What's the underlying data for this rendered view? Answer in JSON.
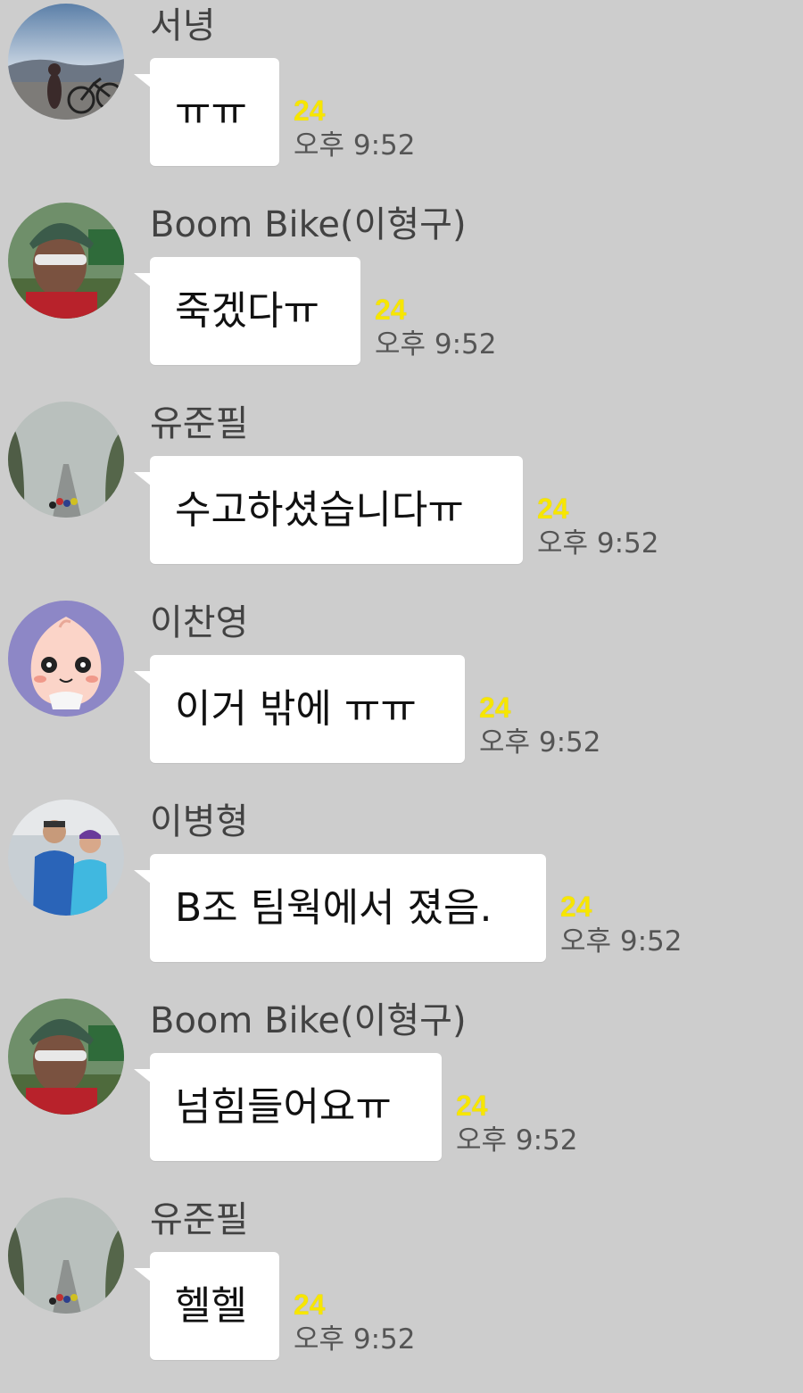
{
  "colors": {
    "background": "#cdcdcd",
    "bubble": "#ffffff",
    "unread_badge": "#f7e600",
    "sender_text": "#424242",
    "time_text": "#555555"
  },
  "messages": [
    {
      "sender": "서녕",
      "text": "ㅠㅠ",
      "unread": "24",
      "time": "오후 9:52",
      "avatar": "mountain-bike-photo"
    },
    {
      "sender": "Boom Bike(이형구)",
      "text": "죽겠다ㅠ",
      "unread": "24",
      "time": "오후 9:52",
      "avatar": "cyclist-helmet-photo"
    },
    {
      "sender": "유준필",
      "text": "수고하셨습니다ㅠ",
      "unread": "24",
      "time": "오후 9:52",
      "avatar": "misty-road-photo"
    },
    {
      "sender": "이찬영",
      "text": "이거 밖에 ㅠㅠ",
      "unread": "24",
      "time": "오후 9:52",
      "avatar": "peach-character"
    },
    {
      "sender": "이병형",
      "text": "B조 팀웍에서 졌음.",
      "unread": "24",
      "time": "오후 9:52",
      "avatar": "couple-photo"
    },
    {
      "sender": "Boom Bike(이형구)",
      "text": "넘힘들어요ㅠ",
      "unread": "24",
      "time": "오후 9:52",
      "avatar": "cyclist-helmet-photo"
    },
    {
      "sender": "유준필",
      "text": "헬헬",
      "unread": "24",
      "time": "오후 9:52",
      "avatar": "misty-road-photo"
    }
  ]
}
